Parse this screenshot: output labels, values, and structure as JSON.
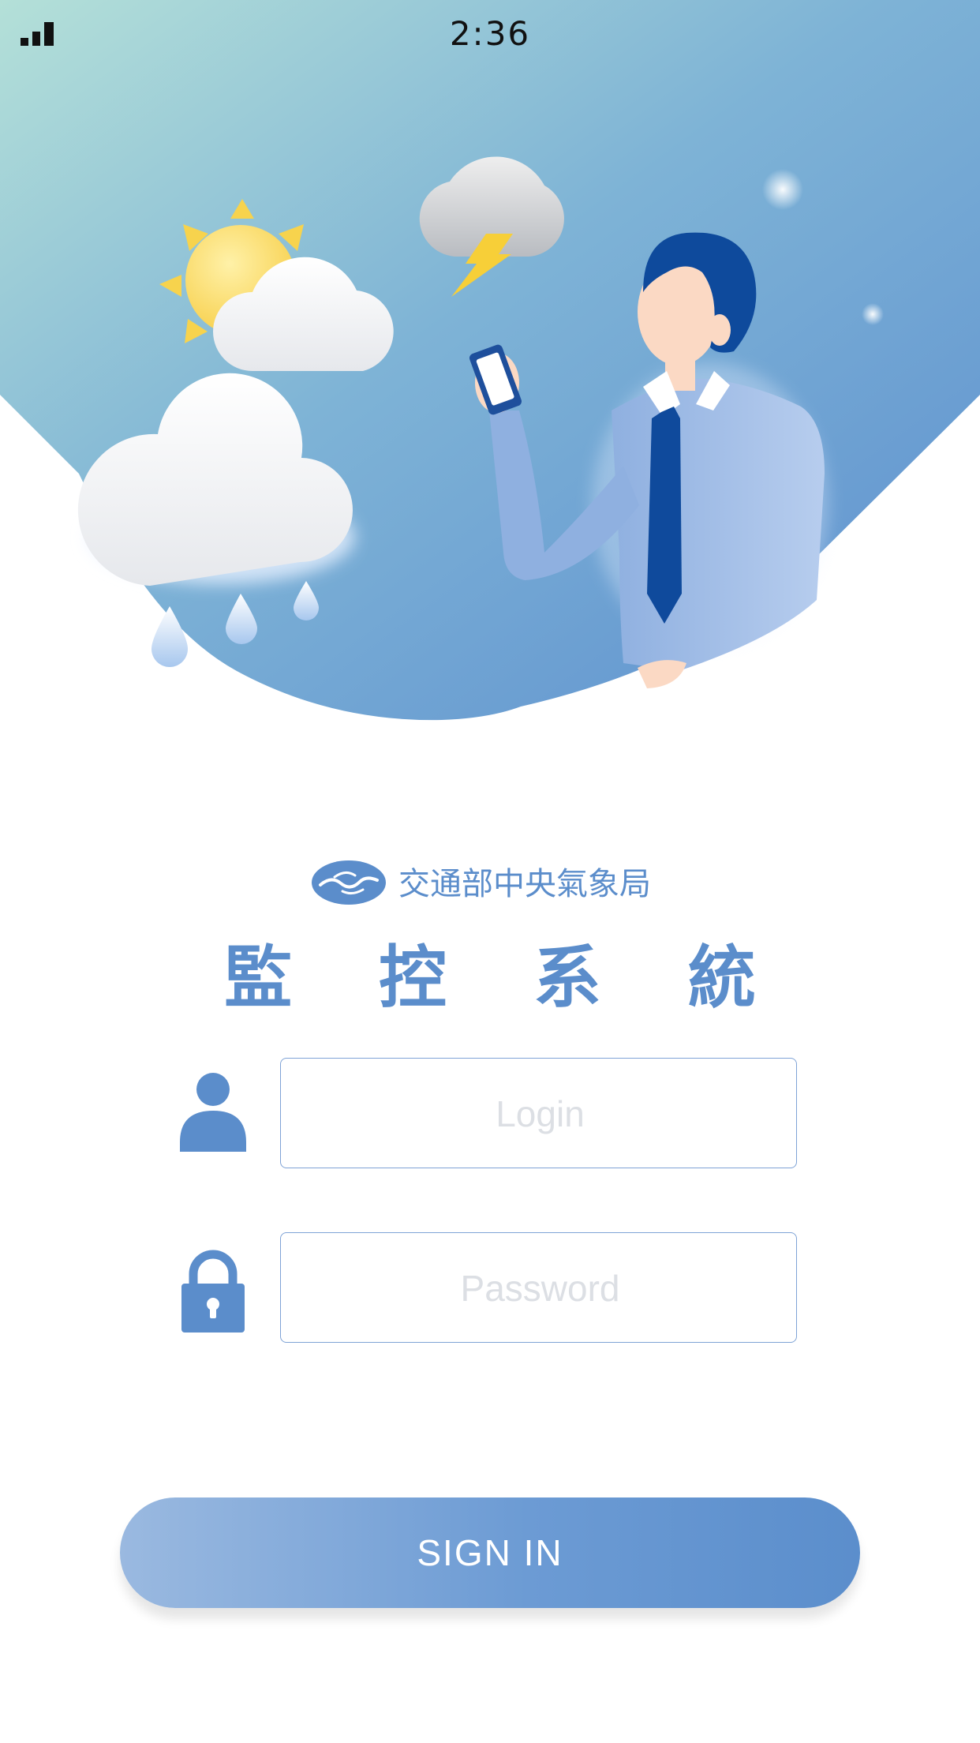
{
  "status_bar": {
    "signal_icon": "signal-bars-icon",
    "time": "2:36"
  },
  "hero": {
    "illustration": "weather-forecaster-illustration",
    "colors": {
      "sky_top_left": "#b4e0d8",
      "sky_mid": "#7eb3d6",
      "sky_bottom": "#5d8fcf"
    }
  },
  "brand": {
    "logo_icon": "cwb-logo-icon",
    "agency_name": "交通部中央氣象局",
    "system_title": "監 控 系 統"
  },
  "form": {
    "login": {
      "icon": "user-icon",
      "placeholder": "Login",
      "value": ""
    },
    "password": {
      "icon": "lock-icon",
      "placeholder": "Password",
      "value": ""
    },
    "sign_in_label": "SIGN IN"
  },
  "colors": {
    "accent": "#5b8dcb",
    "field_border": "#7fa3d6",
    "placeholder": "#dcdfe4",
    "button_gradient_start": "#9ab9e0",
    "button_gradient_end": "#5b8ecc"
  }
}
